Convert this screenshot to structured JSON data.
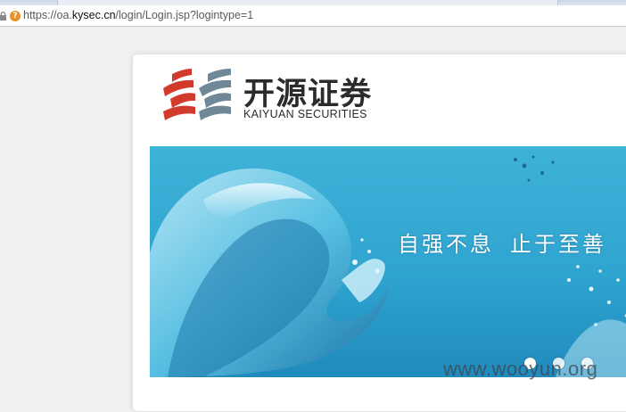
{
  "browser": {
    "url_scheme": "https://oa.",
    "url_domain": "kysec.cn",
    "url_path": "/login/Login.jsp?logintype=1",
    "icons": {
      "lock": "lock-icon",
      "site_info": "info-icon"
    },
    "colors": {
      "site_info": "#e8912a"
    }
  },
  "header": {
    "logo_cn": "开源证券",
    "logo_en": "KAIYUAN SECURITIES",
    "colors": {
      "brand_red": "#d23a2b",
      "brand_gray": "#6f8796"
    }
  },
  "banner": {
    "slogan_part1": "自强不息",
    "slogan_part2": "止于至善",
    "carousel": {
      "slides": 3,
      "active_index": 0
    }
  },
  "watermark": "www.wooyun.org"
}
